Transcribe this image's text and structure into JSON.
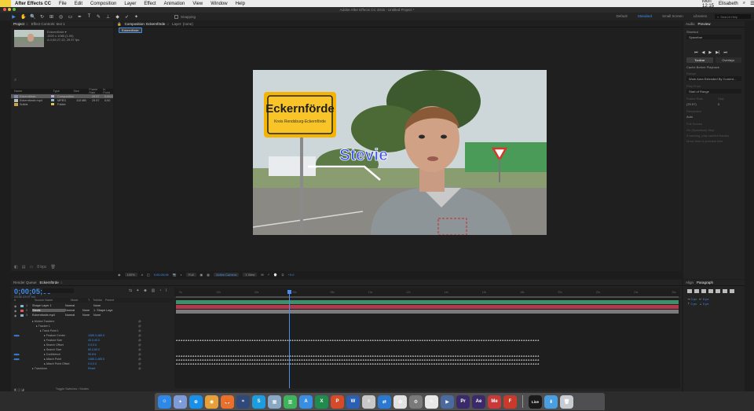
{
  "menubar": {
    "app_name": "After Effects CC",
    "items": [
      "File",
      "Edit",
      "Composition",
      "Layer",
      "Effect",
      "Animation",
      "View",
      "Window",
      "Help"
    ],
    "clock": "Mon 12:15",
    "user": "Elisabeth"
  },
  "window_title": "Adobe After Effects CC 2015 - Untitled Project *",
  "toolbar": {
    "tools": [
      "▶",
      "✋",
      "🔍",
      "↻",
      "⊞",
      "◎",
      "▭",
      "✒",
      "T",
      "✎",
      "⊥",
      "◆",
      "➶",
      "✦"
    ],
    "snapping_label": "Snapping",
    "workspaces": [
      "Default",
      "Standard",
      "Small Screen",
      "Libraries"
    ],
    "search_placeholder": "Search Help"
  },
  "project_panel": {
    "tabs": [
      "Project",
      "Effect Controls: text 1"
    ],
    "selected_item": "Eckernförde ▾",
    "info_lines": [
      "1920 x 1080 (1.00)",
      "Δ 0;00;27;13, 29.97 fps"
    ],
    "search_glyph": "⌕",
    "columns": [
      "Name",
      "Type",
      "Size",
      "Frame Rate",
      "In Point"
    ],
    "rows": [
      {
        "name": "Eckernförde",
        "type": "Composition",
        "size": "",
        "frame_rate": "29.97",
        "in_point": "0;00;0"
      },
      {
        "name": "Eckernforde.mp4",
        "type": "MPEG",
        "size": "115 MB",
        "frame_rate": "29.97",
        "in_point": "0;00"
      },
      {
        "name": "Solids",
        "type": "Folder",
        "size": "",
        "frame_rate": "",
        "in_point": ""
      }
    ],
    "footer_icons": [
      "◧",
      "▤",
      "▭",
      "8 bpc",
      "🗑"
    ]
  },
  "composition_panel": {
    "tabs": [
      "Composition: Eckernförde",
      "Layer: (none)"
    ],
    "comp_pill": "Eckernförde",
    "sign_city": "Eckernförde",
    "sign_sub": "Kreis Rendsburg-Eckernförde",
    "name_text": "Stevie",
    "footer": {
      "zoom": "100%",
      "timecode": "0;00;05;06",
      "quality": "Full",
      "camera": "Active Camera",
      "views": "1 View",
      "exposure": "+0.0"
    }
  },
  "right_panel": {
    "tabs": [
      "Audio",
      "Preview"
    ],
    "shortcut_label": "Shortcut",
    "shortcut_value": "Spacebar",
    "include_toggle": [
      "Toolbar",
      "Overlays"
    ],
    "cache_label": "Cache Before Playback",
    "range_label": "Range",
    "range_value": "Work Area Extended By Current...",
    "play_label": "Play From",
    "play_value": "Start of Range",
    "frame_rate_label": "Frame Rate",
    "frame_rate_value": "(29.97)",
    "skip_label": "Skip",
    "skip_value": "0",
    "resolution_label": "Resolution",
    "resolution_value": "Auto",
    "fullscreen_label": "Full Screen",
    "stop_label": "On (Spacebar) Stop",
    "if_caching_label": "If caching, play cached frames",
    "move_time_label": "Move time to preview time"
  },
  "timeline": {
    "tabs": [
      "Render Queue",
      "Eckernförde"
    ],
    "current_time": "0;00;05;06",
    "fps_info": "00156 (29.97 fps)",
    "columns": [
      "#",
      "Source Name",
      "Mode",
      "T",
      "TrkMat",
      "Parent"
    ],
    "layers": [
      {
        "num": "1",
        "name": "Shape Layer 1",
        "mode": "Normal",
        "trkmat": "",
        "parent": "None",
        "color": "#7fb6c9",
        "bar": "#3e8f6a"
      },
      {
        "num": "2",
        "name": "Stevie",
        "mode": "Normal",
        "trkmat": "None",
        "parent": "1. Shape Laye",
        "color": "#d35a5a",
        "bar": "#b2374f"
      },
      {
        "num": "3",
        "name": "Eckernforde.mp4",
        "mode": "Normal",
        "trkmat": "None",
        "parent": "None",
        "color": "#8bb0c9",
        "bar": "#7b7b7b"
      }
    ],
    "properties": [
      {
        "name": "Motion Trackers",
        "value": "",
        "indent": 1,
        "key": false
      },
      {
        "name": "Tracker 1",
        "value": "",
        "indent": 2,
        "key": false
      },
      {
        "name": "Track Point 1",
        "value": "",
        "indent": 3,
        "key": false
      },
      {
        "name": "Feature Center",
        "value": "1085.3,485.5",
        "indent": 4,
        "key": true
      },
      {
        "name": "Feature Size",
        "value": "40.0,40.0",
        "indent": 4,
        "key": false
      },
      {
        "name": "Search Offset",
        "value": "0.0,0.0",
        "indent": 4,
        "key": false
      },
      {
        "name": "Search Size",
        "value": "80.0,80.0",
        "indent": 4,
        "key": false
      },
      {
        "name": "Confidence",
        "value": "99.6%",
        "indent": 4,
        "key": true
      },
      {
        "name": "Attach Point",
        "value": "1085.3,485.5",
        "indent": 4,
        "key": true
      },
      {
        "name": "Attach Point Offset",
        "value": "0.0,0.0",
        "indent": 4,
        "key": false
      },
      {
        "name": "Transform",
        "value": "Reset",
        "indent": 1,
        "key": false
      }
    ],
    "ruler_labels": [
      "0s",
      "02s",
      "04s",
      "06s",
      "08s",
      "10s",
      "12s",
      "14s",
      "16s",
      "18s",
      "20s",
      "22s",
      "24s",
      "26s"
    ],
    "toggle_label": "Toggle Switches / Modes"
  },
  "paragraph_panel": {
    "tabs": [
      "Align",
      "Paragraph"
    ],
    "indent_left": "0 px",
    "indent_right": "0 px",
    "space_before": "0 px",
    "space_after": "0 px"
  },
  "dock": [
    {
      "name": "finder",
      "color": "#2d88e8",
      "label": "☺"
    },
    {
      "name": "launchpad",
      "color": "#7d9bd6",
      "label": "✦"
    },
    {
      "name": "safari",
      "color": "#1a8fe8",
      "label": "⊕"
    },
    {
      "name": "chrome",
      "color": "#e5a03a",
      "label": "◉"
    },
    {
      "name": "firefox",
      "color": "#e8702c",
      "label": "🦊"
    },
    {
      "name": "steam",
      "color": "#2f4a7a",
      "label": "≈"
    },
    {
      "name": "skype",
      "color": "#1d9de0",
      "label": "S"
    },
    {
      "name": "preview",
      "color": "#89a8c6",
      "label": "▦"
    },
    {
      "name": "numbers",
      "color": "#3fb25b",
      "label": "▥"
    },
    {
      "name": "app-store",
      "color": "#3a8ee2",
      "label": "A"
    },
    {
      "name": "excel",
      "color": "#1f8b4c",
      "label": "X"
    },
    {
      "name": "powerpoint",
      "color": "#d54b2a",
      "label": "P"
    },
    {
      "name": "word",
      "color": "#2b5fb4",
      "label": "W"
    },
    {
      "name": "notes",
      "color": "#c8c8c8",
      "label": "≡"
    },
    {
      "name": "teamviewer",
      "color": "#2a78d0",
      "label": "⇄"
    },
    {
      "name": "photos",
      "color": "#e2e2e2",
      "label": "✿"
    },
    {
      "name": "system-preferences",
      "color": "#7a7a7a",
      "label": "⚙"
    },
    {
      "name": "textedit",
      "color": "#e8e8e8",
      "label": "✎"
    },
    {
      "name": "quicktime",
      "color": "#4a6aa0",
      "label": "▶"
    },
    {
      "name": "premiere",
      "color": "#3a2a6a",
      "label": "Pr"
    },
    {
      "name": "after-effects",
      "color": "#3a2a6a",
      "label": "Ae"
    },
    {
      "name": "media-encoder",
      "color": "#c83a3a",
      "label": "Me"
    },
    {
      "name": "filezilla",
      "color": "#c83a2a",
      "label": "F"
    },
    {
      "name": "sep",
      "color": "",
      "label": ""
    },
    {
      "name": "live",
      "color": "#1a1a1a",
      "label": "Live"
    },
    {
      "name": "downloads-folder",
      "color": "#4a9fe0",
      "label": "⬇"
    },
    {
      "name": "trash",
      "color": "#c8ccd2",
      "label": "🗑"
    }
  ]
}
